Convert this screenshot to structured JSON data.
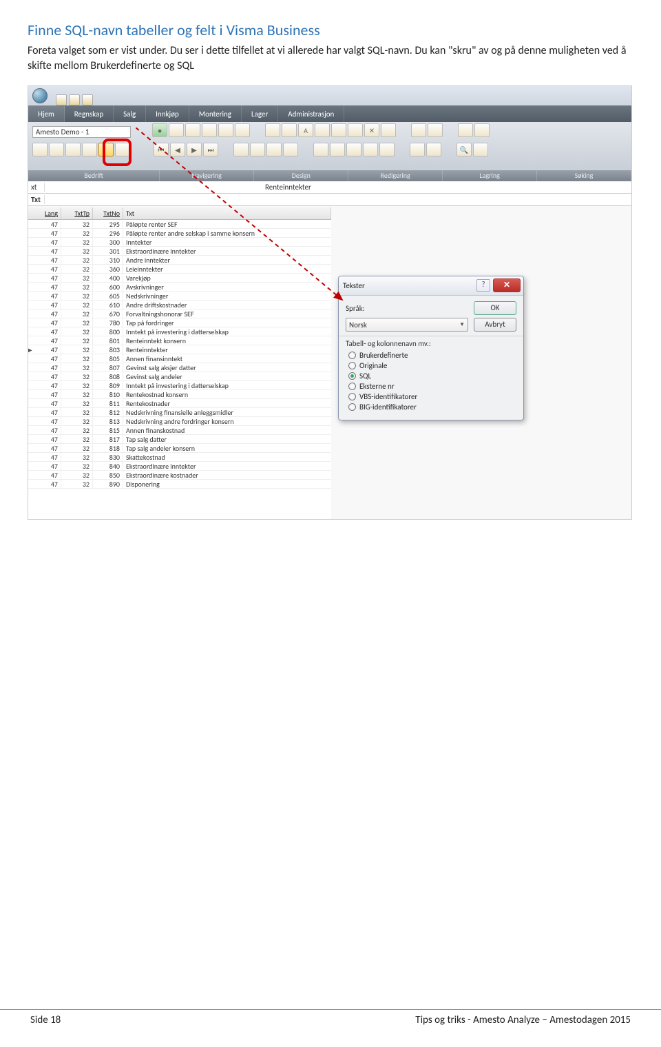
{
  "heading": "Finne SQL-navn tabeller og felt i Visma Business",
  "body_text": "Foreta valget som er vist under. Du ser i dette tilfellet at vi allerede har valgt SQL-navn. Du kan \"skru\" av og på denne muligheten ved å skifte mellom Brukerdefinerte og SQL",
  "ribbon": {
    "tabs": [
      "Hjem",
      "Regnskap",
      "Salg",
      "Innkjøp",
      "Montering",
      "Lager",
      "Administrasjon"
    ],
    "groups": [
      "Bedrift",
      "Navigering",
      "Design",
      "Redigering",
      "Lagring",
      "Søking"
    ],
    "company": "Amesto Demo - 1"
  },
  "formula": {
    "label1": "xt",
    "value1": "Renteinntekter",
    "label2": "Txt"
  },
  "grid": {
    "headers": [
      "Lang",
      "TxtTp",
      "TxtNo",
      "Txt"
    ],
    "rows": [
      [
        "47",
        "32",
        "295",
        "Påløpte renter SEF"
      ],
      [
        "47",
        "32",
        "296",
        "Påløpte renter andre selskap i samme konsern"
      ],
      [
        "47",
        "32",
        "300",
        "Inntekter"
      ],
      [
        "47",
        "32",
        "301",
        "Ekstraordinære inntekter"
      ],
      [
        "47",
        "32",
        "310",
        "Andre inntekter"
      ],
      [
        "47",
        "32",
        "360",
        "Leieinntekter"
      ],
      [
        "47",
        "32",
        "400",
        "Varekjøp"
      ],
      [
        "47",
        "32",
        "600",
        "Avskrivninger"
      ],
      [
        "47",
        "32",
        "605",
        "Nedskrivninger"
      ],
      [
        "47",
        "32",
        "610",
        "Andre driftskostnader"
      ],
      [
        "47",
        "32",
        "670",
        "Forvaltningshonorar SEF"
      ],
      [
        "47",
        "32",
        "780",
        "Tap på fordringer"
      ],
      [
        "47",
        "32",
        "800",
        "Inntekt på investering i datterselskap"
      ],
      [
        "47",
        "32",
        "801",
        "Renteinntekt konsern"
      ],
      [
        "47",
        "32",
        "803",
        "Renteinntekter"
      ],
      [
        "47",
        "32",
        "805",
        "Annen finansinntekt"
      ],
      [
        "47",
        "32",
        "807",
        "Gevinst salg aksjer datter"
      ],
      [
        "47",
        "32",
        "808",
        "Gevinst salg andeler"
      ],
      [
        "47",
        "32",
        "809",
        "Inntekt på investering i datterselskap"
      ],
      [
        "47",
        "32",
        "810",
        "Rentekostnad konsern"
      ],
      [
        "47",
        "32",
        "811",
        "Rentekostnader"
      ],
      [
        "47",
        "32",
        "812",
        "Nedskrivning finansielle anleggsmidler"
      ],
      [
        "47",
        "32",
        "813",
        "Nedskrivning andre fordringer konsern"
      ],
      [
        "47",
        "32",
        "815",
        "Annen finanskostnad"
      ],
      [
        "47",
        "32",
        "817",
        "Tap salg datter"
      ],
      [
        "47",
        "32",
        "818",
        "Tap salg andeler konsern"
      ],
      [
        "47",
        "32",
        "830",
        "Skattekostnad"
      ],
      [
        "47",
        "32",
        "840",
        "Ekstraordinære inntekter"
      ],
      [
        "47",
        "32",
        "850",
        "Ekstraordinære kostnader"
      ],
      [
        "47",
        "32",
        "890",
        "Disponering"
      ]
    ],
    "selected_row_index": 14
  },
  "dialog": {
    "title": "Tekster",
    "language_label": "Språk:",
    "language_value": "Norsk",
    "ok": "OK",
    "cancel": "Avbryt",
    "group_label": "Tabell- og kolonnenavn mv.:",
    "options": [
      "Brukerdefinerte",
      "Originale",
      "SQL",
      "Eksterne nr",
      "VBS-identifikatorer",
      "BIG-identifikatorer"
    ],
    "selected": "SQL"
  },
  "footer": {
    "left": "Side 18",
    "right": "Tips og triks - Amesto Analyze – Amestodagen 2015"
  }
}
